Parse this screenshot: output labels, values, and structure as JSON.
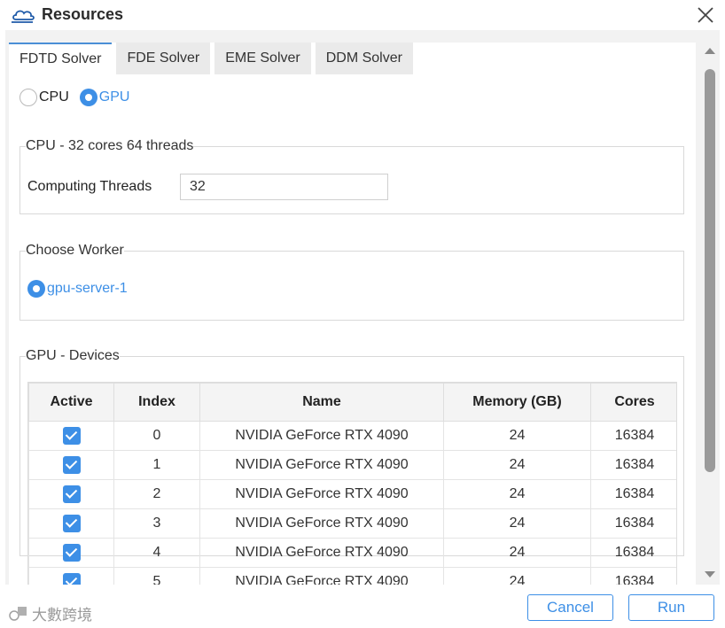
{
  "window": {
    "title": "Resources"
  },
  "tabs": [
    {
      "label": "FDTD Solver",
      "active": true
    },
    {
      "label": "FDE Solver",
      "active": false
    },
    {
      "label": "EME Solver",
      "active": false
    },
    {
      "label": "DDM Solver",
      "active": false
    }
  ],
  "mode": {
    "cpu_label": "CPU",
    "gpu_label": "GPU",
    "selected": "GPU"
  },
  "cpu_group": {
    "legend": "CPU - 32 cores 64 threads",
    "threads_label": "Computing Threads",
    "threads_value": "32"
  },
  "worker_group": {
    "legend": "Choose Worker",
    "worker_label": "gpu-server-1"
  },
  "gpu_group": {
    "legend": "GPU - Devices",
    "columns": [
      "Active",
      "Index",
      "Name",
      "Memory (GB)",
      "Cores"
    ],
    "rows": [
      {
        "active": true,
        "index": "0",
        "name": "NVIDIA GeForce RTX 4090",
        "memory": "24",
        "cores": "16384"
      },
      {
        "active": true,
        "index": "1",
        "name": "NVIDIA GeForce RTX 4090",
        "memory": "24",
        "cores": "16384"
      },
      {
        "active": true,
        "index": "2",
        "name": "NVIDIA GeForce RTX 4090",
        "memory": "24",
        "cores": "16384"
      },
      {
        "active": true,
        "index": "3",
        "name": "NVIDIA GeForce RTX 4090",
        "memory": "24",
        "cores": "16384"
      },
      {
        "active": true,
        "index": "4",
        "name": "NVIDIA GeForce RTX 4090",
        "memory": "24",
        "cores": "16384"
      },
      {
        "active": true,
        "index": "5",
        "name": "NVIDIA GeForce RTX 4090",
        "memory": "24",
        "cores": "16384"
      }
    ]
  },
  "buttons": {
    "cancel_label": "Cancel",
    "run_label": "Run"
  },
  "watermark": {
    "text": "大數跨境"
  },
  "icons": {
    "app": "cloud-icon",
    "close": "close-icon"
  },
  "colors": {
    "accent": "#3d8fe6"
  }
}
